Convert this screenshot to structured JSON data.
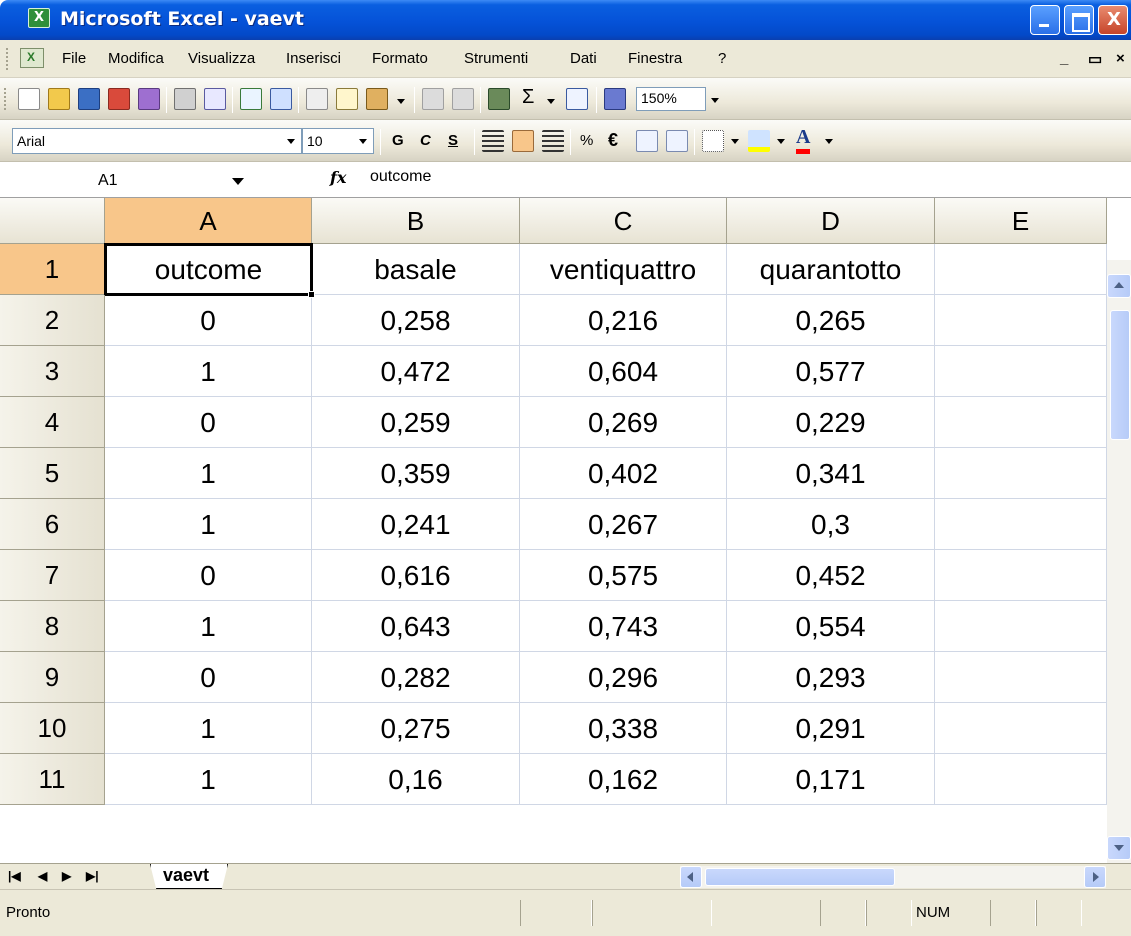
{
  "window": {
    "title": "Microsoft Excel - vaevt"
  },
  "menu": {
    "items": [
      "File",
      "Modifica",
      "Visualizza",
      "Inserisci",
      "Formato",
      "Strumenti",
      "Dati",
      "Finestra",
      "?"
    ]
  },
  "toolbar_standard": {
    "zoom": "150%",
    "icons": [
      "new-icon",
      "open-icon",
      "save-icon",
      "permission-icon",
      "print-icon",
      "print-preview-icon",
      "spelling-icon",
      "research-icon",
      "cut-icon",
      "copy-icon",
      "paste-icon",
      "undo-icon",
      "redo-icon",
      "insert-hyperlink-icon",
      "autosum-icon",
      "sort-ascending-icon",
      "chart-wizard-icon"
    ]
  },
  "toolbar_format": {
    "font": "Arial",
    "size": "10",
    "bold": "G",
    "italic": "C",
    "underline": "S",
    "percent": "%",
    "currency": "€",
    "fill_color": "#ffff00",
    "font_color": "#ff0000"
  },
  "formula_bar": {
    "name_box": "A1",
    "fx": "fx",
    "content": "outcome"
  },
  "grid": {
    "columns": [
      "A",
      "B",
      "C",
      "D",
      "E"
    ],
    "rows": [
      "1",
      "2",
      "3",
      "4",
      "5",
      "6",
      "7",
      "8",
      "9",
      "10",
      "11"
    ],
    "cells": [
      [
        "outcome",
        "basale",
        "ventiquattro",
        "quarantotto",
        ""
      ],
      [
        "0",
        "0,258",
        "0,216",
        "0,265",
        ""
      ],
      [
        "1",
        "0,472",
        "0,604",
        "0,577",
        ""
      ],
      [
        "0",
        "0,259",
        "0,269",
        "0,229",
        ""
      ],
      [
        "1",
        "0,359",
        "0,402",
        "0,341",
        ""
      ],
      [
        "1",
        "0,241",
        "0,267",
        "0,3",
        ""
      ],
      [
        "0",
        "0,616",
        "0,575",
        "0,452",
        ""
      ],
      [
        "1",
        "0,643",
        "0,743",
        "0,554",
        ""
      ],
      [
        "0",
        "0,282",
        "0,296",
        "0,293",
        ""
      ],
      [
        "1",
        "0,275",
        "0,338",
        "0,291",
        ""
      ],
      [
        "1",
        "0,16",
        "0,162",
        "0,171",
        ""
      ]
    ],
    "selection_color": "#f8c68a"
  },
  "sheets": {
    "tabs": [
      "vaevt"
    ]
  },
  "status": {
    "text": "Pronto",
    "num": "NUM"
  }
}
